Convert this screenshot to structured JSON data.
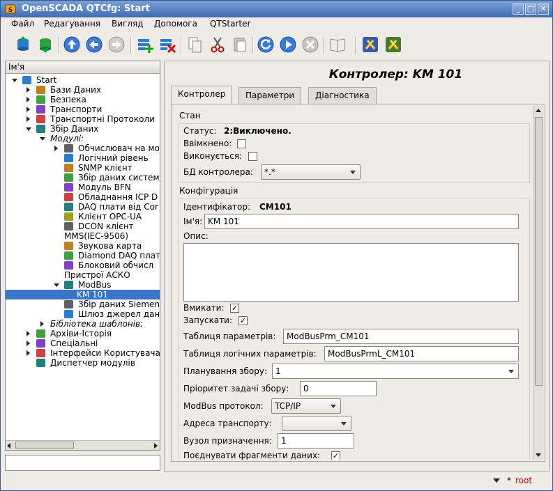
{
  "window": {
    "title": "OpenSCADA QTCfg: Start"
  },
  "menu": [
    "Файл",
    "Редагування",
    "Вигляд",
    "Допомога",
    "QTStarter"
  ],
  "tree": {
    "header": "Ім'я",
    "rows": [
      {
        "label": "Start",
        "depth": 0,
        "exp": "down",
        "icon": "start-icon",
        "italic": false
      },
      {
        "label": "Бази Даних",
        "depth": 1,
        "exp": "right",
        "icon": "database-icon",
        "italic": false
      },
      {
        "label": "Безпека",
        "depth": 1,
        "exp": "right",
        "icon": "security-icon",
        "italic": false
      },
      {
        "label": "Транспорти",
        "depth": 1,
        "exp": "right",
        "icon": "transport-icon",
        "italic": false
      },
      {
        "label": "Транспортні Протоколи",
        "depth": 1,
        "exp": "right",
        "icon": "protocol-icon",
        "italic": false
      },
      {
        "label": "Збір Даних",
        "depth": 1,
        "exp": "down",
        "icon": "daq-icon",
        "italic": false
      },
      {
        "label": "Модулі:",
        "depth": 2,
        "exp": "down",
        "icon": "",
        "italic": true
      },
      {
        "label": "Обчислювач на мо",
        "depth": 3,
        "exp": "right",
        "icon": "calculator-icon",
        "italic": false
      },
      {
        "label": "Логічний рівень",
        "depth": 3,
        "exp": "",
        "icon": "logic-level-icon",
        "italic": false
      },
      {
        "label": "SNMP клієнт",
        "depth": 3,
        "exp": "",
        "icon": "snmp-icon",
        "italic": false
      },
      {
        "label": "Збір даних систем",
        "depth": 3,
        "exp": "",
        "icon": "system-daq-icon",
        "italic": false
      },
      {
        "label": "Модуль BFN",
        "depth": 3,
        "exp": "",
        "icon": "bfn-icon",
        "italic": false
      },
      {
        "label": "Обладнання ICP D",
        "depth": 3,
        "exp": "",
        "icon": "icp-das-icon",
        "italic": false
      },
      {
        "label": "DAQ плати від Cor",
        "depth": 3,
        "exp": "",
        "icon": "daq-board-icon",
        "italic": false
      },
      {
        "label": "Клієнт OPC-UA",
        "depth": 3,
        "exp": "",
        "icon": "opc-ua-icon",
        "italic": false
      },
      {
        "label": "DCON клієнт",
        "depth": 3,
        "exp": "",
        "icon": "dcon-icon",
        "italic": false
      },
      {
        "label": "MMS(IEC-9506)",
        "depth": 3,
        "exp": "",
        "icon": "",
        "italic": false
      },
      {
        "label": "Звукова карта",
        "depth": 3,
        "exp": "",
        "icon": "soundcard-icon",
        "italic": false
      },
      {
        "label": "Diamond DAQ плат",
        "depth": 3,
        "exp": "",
        "icon": "diamond-daq-icon",
        "italic": false
      },
      {
        "label": "Блоковий обчисл",
        "depth": 3,
        "exp": "",
        "icon": "block-calc-icon",
        "italic": false
      },
      {
        "label": "Пристрої АСКО",
        "depth": 3,
        "exp": "",
        "icon": "",
        "italic": false
      },
      {
        "label": "ModBus",
        "depth": 3,
        "exp": "down",
        "icon": "modbus-icon",
        "italic": false
      },
      {
        "label": "KM 101",
        "depth": 4,
        "exp": "",
        "icon": "",
        "italic": false,
        "selected": true
      },
      {
        "label": "Збір даних Siemen",
        "depth": 3,
        "exp": "",
        "icon": "siemens-icon",
        "italic": false
      },
      {
        "label": "Шлюз джерел дан",
        "depth": 3,
        "exp": "",
        "icon": "gateway-icon",
        "italic": false
      },
      {
        "label": "Бібліотека шаблонів:",
        "depth": 2,
        "exp": "right",
        "icon": "",
        "italic": true
      },
      {
        "label": "Архіви-Історія",
        "depth": 1,
        "exp": "right",
        "icon": "archive-icon",
        "italic": false
      },
      {
        "label": "Спеціальні",
        "depth": 1,
        "exp": "right",
        "icon": "special-icon",
        "italic": false
      },
      {
        "label": "Інтерфейси Користувача",
        "depth": 1,
        "exp": "right",
        "icon": "ui-icon",
        "italic": false
      },
      {
        "label": "Диспетчер модулів",
        "depth": 1,
        "exp": "",
        "icon": "module-manager-icon",
        "italic": false
      }
    ]
  },
  "content": {
    "title": "Контролер: KM 101",
    "tabs": [
      "Контролер",
      "Параметри",
      "Діагностика"
    ],
    "state": {
      "group_label": "Стан",
      "status_label": "Статус:",
      "status_value": "2:Виключено.",
      "enabled_label": "Ввімкнено:",
      "enabled": false,
      "running_label": "Виконується:",
      "running": false,
      "db_label": "БД контролера:",
      "db_value": "*.*"
    },
    "config": {
      "group_label": "Конфігурація",
      "id_label": "Ідентифікатор:",
      "id_value": "CM101",
      "name_label": "Ім'я:",
      "name_value": "KM 101",
      "descr_label": "Опис:",
      "descr_value": "",
      "enable_label": "Вмикати:",
      "enable": true,
      "start_label": "Запускати:",
      "start": true,
      "prm_table_label": "Таблиця параметрів:",
      "prm_table_value": "ModBusPrm_CM101",
      "prml_table_label": "Таблиця логічних параметрів:",
      "prml_table_value": "ModBusPrmL_CM101",
      "schedule_label": "Планування збору:",
      "schedule_value": "1",
      "priority_label": "Пріоритет задачі збору:",
      "priority_value": "0",
      "protocol_label": "ModBus протокол:",
      "protocol_value": "TCP/IP",
      "addr_label": "Адреса транспорту:",
      "addr_value": "",
      "node_label": "Вузол призначення:",
      "node_value": "1",
      "merge_label": "Поєднувати фрагменти даних:",
      "merge": true
    }
  },
  "status": {
    "mark": "*",
    "user": "root",
    "user_color": "#cc0000"
  }
}
